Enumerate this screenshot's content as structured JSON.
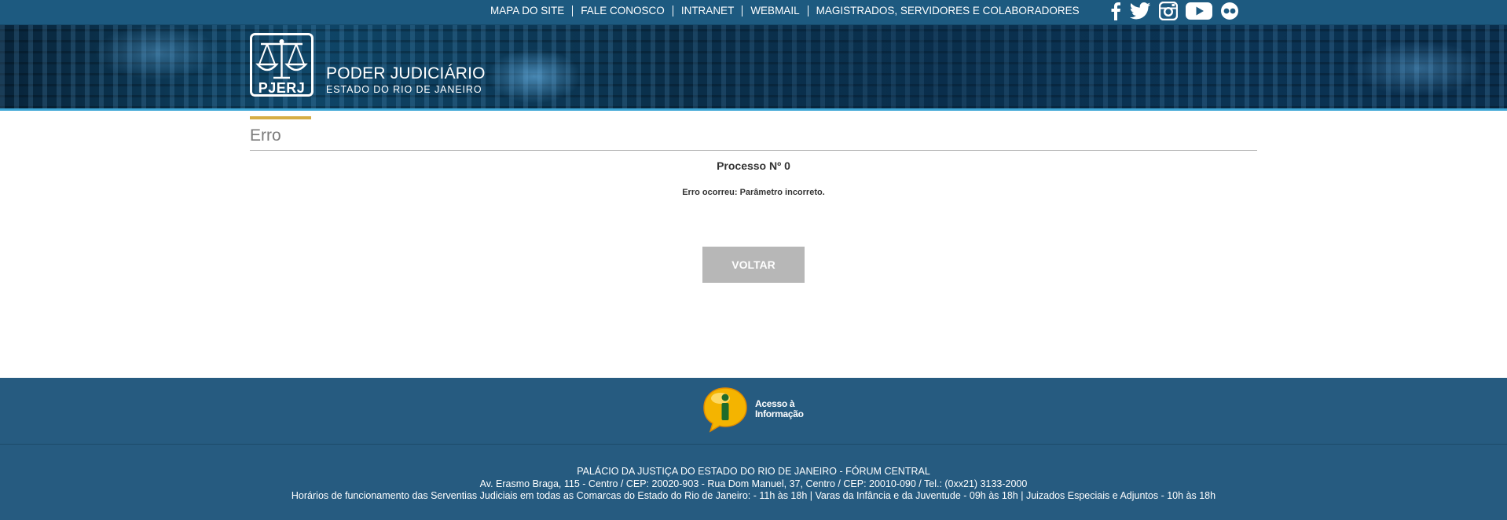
{
  "topnav": {
    "links": [
      "MAPA DO SITE",
      "FALE CONOSCO",
      "INTRANET",
      "WEBMAIL",
      "MAGISTRADOS, SERVIDORES E COLABORADORES"
    ],
    "social_icons": [
      "facebook-icon",
      "twitter-icon",
      "instagram-icon",
      "youtube-icon",
      "flickr-icon"
    ]
  },
  "header": {
    "logo_text": "PJERJ",
    "title": "PODER JUDICIÁRIO",
    "subtitle": "ESTADO DO RIO DE JANEIRO"
  },
  "main": {
    "section_title": "Erro",
    "processo": "Processo Nº 0",
    "error_message": "Erro ocorreu: Parâmetro incorreto.",
    "back_button": "VOLTAR"
  },
  "footer": {
    "acesso_line1": "Acesso à",
    "acesso_line2": "Informação",
    "lines": [
      "PALÁCIO DA JUSTIÇA DO ESTADO DO RIO DE JANEIRO - FÓRUM CENTRAL",
      "Av. Erasmo Braga, 115 - Centro / CEP: 20020-903 - Rua Dom Manuel, 37, Centro / CEP: 20010-090 / Tel.: (0xx21) 3133-2000",
      "Horários de funcionamento das Serventias Judiciais em todas as Comarcas do Estado do Rio de Janeiro: - 11h às 18h | Varas da Infância e da Juventude - 09h às 18h | Juizados Especiais e Adjuntos - 10h às 18h"
    ]
  },
  "colors": {
    "topbar": "#1d5a80",
    "accent_gold": "#d6ad44",
    "banner_line": "#3fa7d6",
    "button_gray": "#b7b7b7",
    "footer": "#265b80"
  }
}
